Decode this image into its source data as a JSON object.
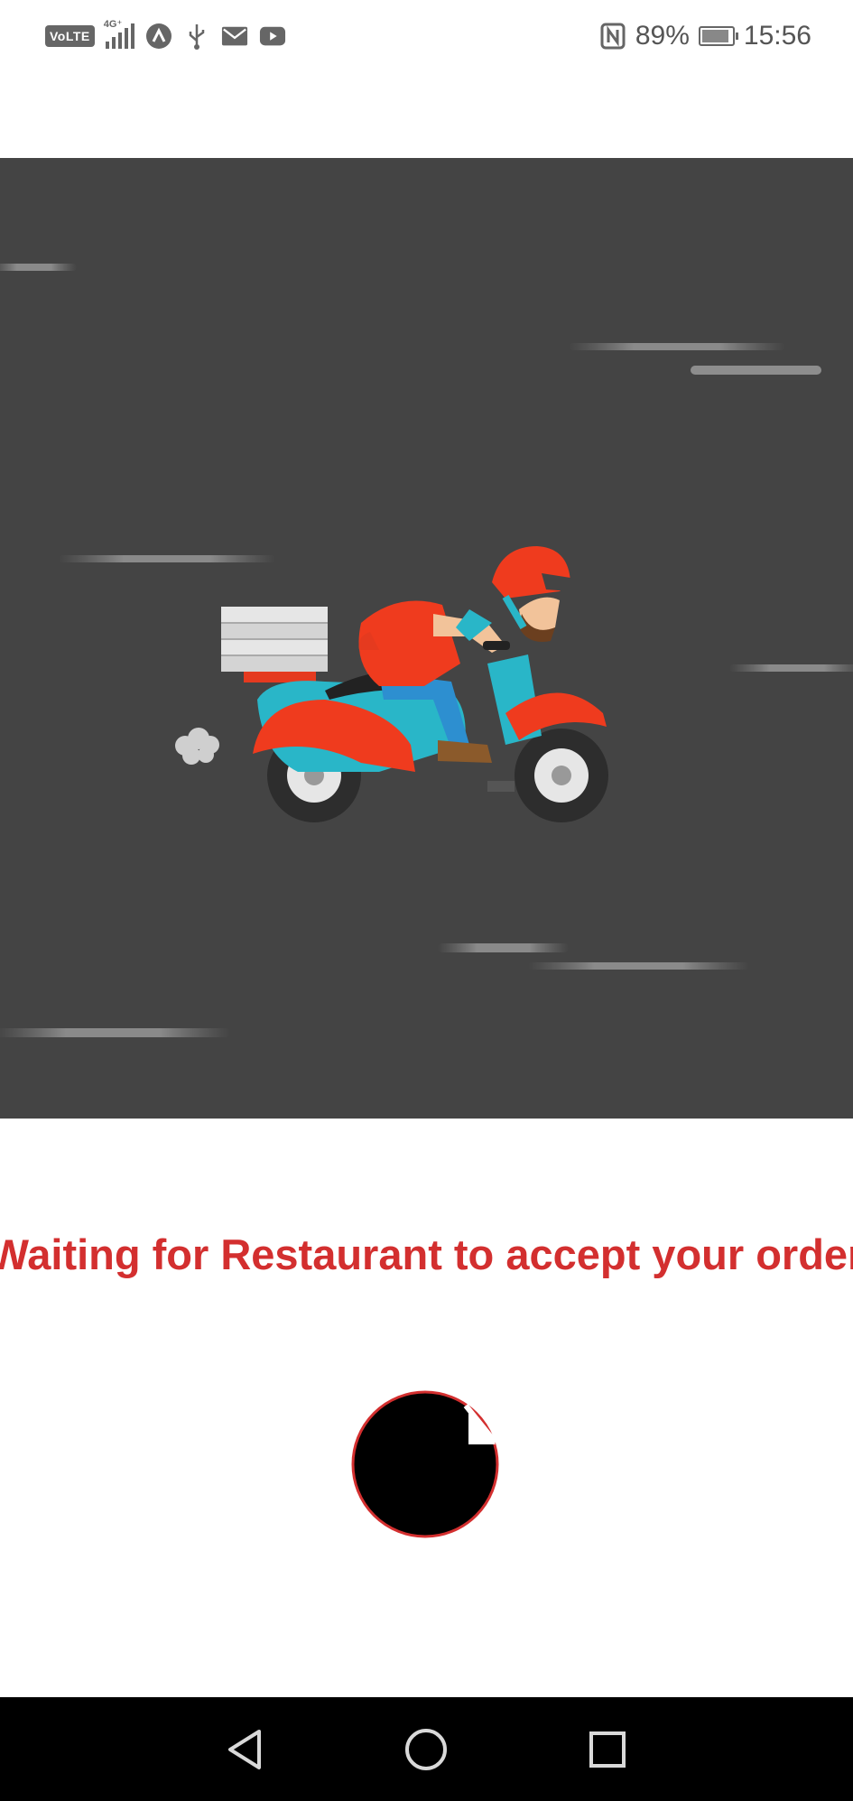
{
  "status_bar": {
    "network_badge": "VoLTE",
    "network_type": "4G⁺",
    "battery_percent": "89%",
    "battery_level": 0.89,
    "time": "15:56",
    "icons": [
      "volte-icon",
      "signal-icon",
      "app-icon",
      "usb-icon",
      "mail-icon",
      "youtube-icon",
      "nfc-icon",
      "battery-icon"
    ]
  },
  "hero": {
    "illustration": "delivery-scooter-illustration",
    "background_color": "#444444"
  },
  "order_status": {
    "message": "Waiting for Restaurant to accept your order",
    "color": "#d32f2f"
  },
  "loader": {
    "icon": "loading-spinner-icon"
  },
  "nav_bar": {
    "buttons": [
      "back-icon",
      "home-icon",
      "recents-icon"
    ]
  }
}
